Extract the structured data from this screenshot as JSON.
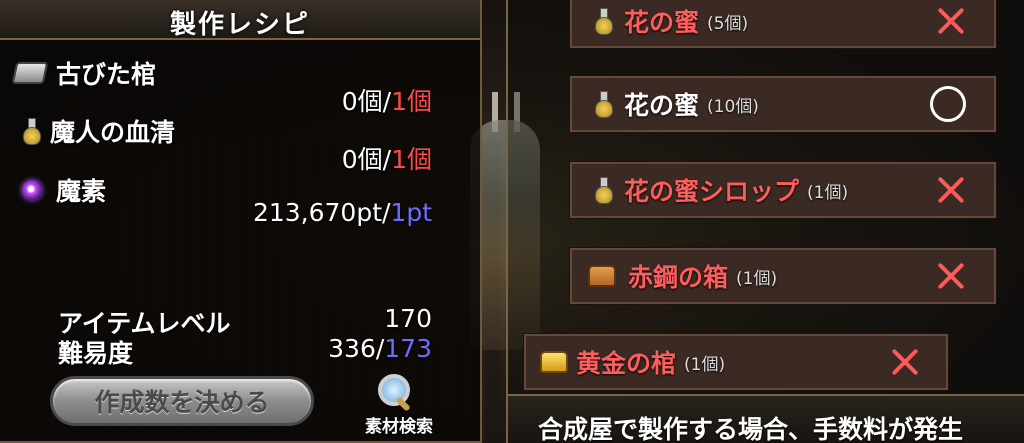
{
  "recipe": {
    "title": "製作レシピ",
    "materials": [
      {
        "name": "古びた棺",
        "have": "0個/",
        "need": "1個",
        "icon": "coffin-icon"
      },
      {
        "name": "魔人の血清",
        "have": "0個/",
        "need": "1個",
        "icon": "potion-icon"
      },
      {
        "name": "魔素",
        "have": "213,670pt/",
        "need": "1pt",
        "icon": "orb-icon"
      }
    ],
    "item_level_label": "アイテムレベル",
    "item_level_value": "170",
    "difficulty_label": "難易度",
    "difficulty_have": "336/",
    "difficulty_need": "173",
    "make_button_label": "作成数を決める",
    "search_label": "素材検索"
  },
  "products": [
    {
      "name": "花の蜜",
      "qty": "(5個)",
      "status": "x",
      "icon": "potion-icon"
    },
    {
      "name": "花の蜜",
      "qty": "(10個)",
      "status": "o",
      "icon": "potion-icon"
    },
    {
      "name": "花の蜜シロップ",
      "qty": "(1個)",
      "status": "x",
      "icon": "potion-icon"
    },
    {
      "name": "赤鋼の箱",
      "qty": "(1個)",
      "status": "x",
      "icon": "box-icon"
    },
    {
      "name": "黄金の棺",
      "qty": "(1個)",
      "status": "x",
      "icon": "gold-box-icon"
    }
  ],
  "notice": "合成屋で製作する場合、手数料が発生",
  "colors": {
    "need_red": "#ff4a4a",
    "need_blue": "#6f6cff",
    "item_red": "#ff5c5c"
  }
}
